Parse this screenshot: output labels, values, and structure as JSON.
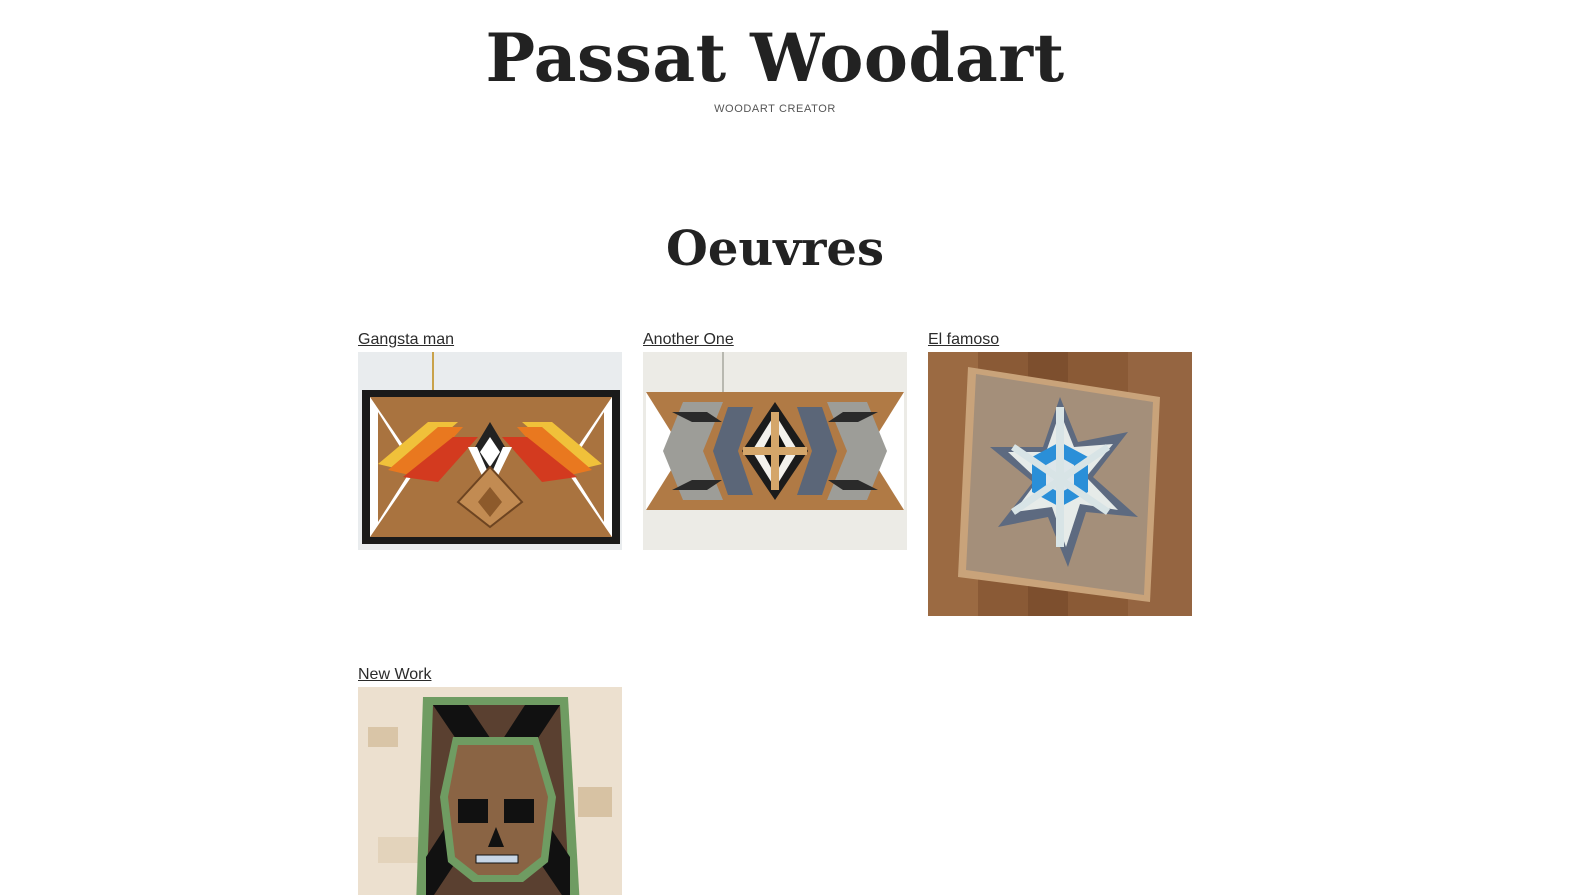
{
  "site": {
    "title": "Passat Woodart",
    "tagline": "WOODART CREATOR"
  },
  "page": {
    "heading": "Oeuvres"
  },
  "gallery": {
    "items": [
      {
        "label": "Gangsta man"
      },
      {
        "label": "Another One"
      },
      {
        "label": "El famoso"
      },
      {
        "label": "New Work"
      }
    ]
  },
  "colors": {
    "text": "#2b2b2b",
    "background": "#ffffff"
  }
}
